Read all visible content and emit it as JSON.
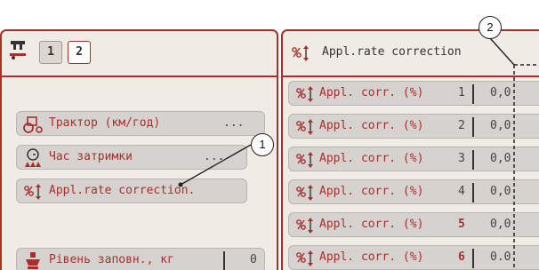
{
  "left": {
    "tabs": [
      "1",
      "2"
    ],
    "rows": [
      {
        "label": "Трактор (км/год)",
        "value": "...",
        "icon": "tractor-icon"
      },
      {
        "label": "Час затримки",
        "value": "...",
        "icon": "delay-clock-icon"
      },
      {
        "label": "Appl.rate correction.",
        "value": "",
        "icon": "rate-correction-icon"
      },
      {
        "label": "Рівень заповн., кг",
        "value": "0",
        "icon": "fill-level-icon"
      }
    ]
  },
  "right": {
    "title": "Appl.rate correction",
    "title_icon": "rate-correction-icon",
    "rows": [
      {
        "label": "Appl. corr. (%)",
        "index": "1",
        "value": "0,0"
      },
      {
        "label": "Appl. corr. (%)",
        "index": "2",
        "value": "0,0"
      },
      {
        "label": "Appl. corr. (%)",
        "index": "3",
        "value": "0,0"
      },
      {
        "label": "Appl. corr. (%)",
        "index": "4",
        "value": "0,0"
      },
      {
        "label": "Appl. corr. (%)",
        "index": "5",
        "value": "0,0"
      },
      {
        "label": "Appl. corr. (%)",
        "index": "6",
        "value": "0.0"
      }
    ]
  },
  "callouts": [
    "1",
    "2"
  ],
  "colors": {
    "accent": "#a8302c",
    "panel": "#f1ebe5",
    "row": "#d5d2cf"
  }
}
